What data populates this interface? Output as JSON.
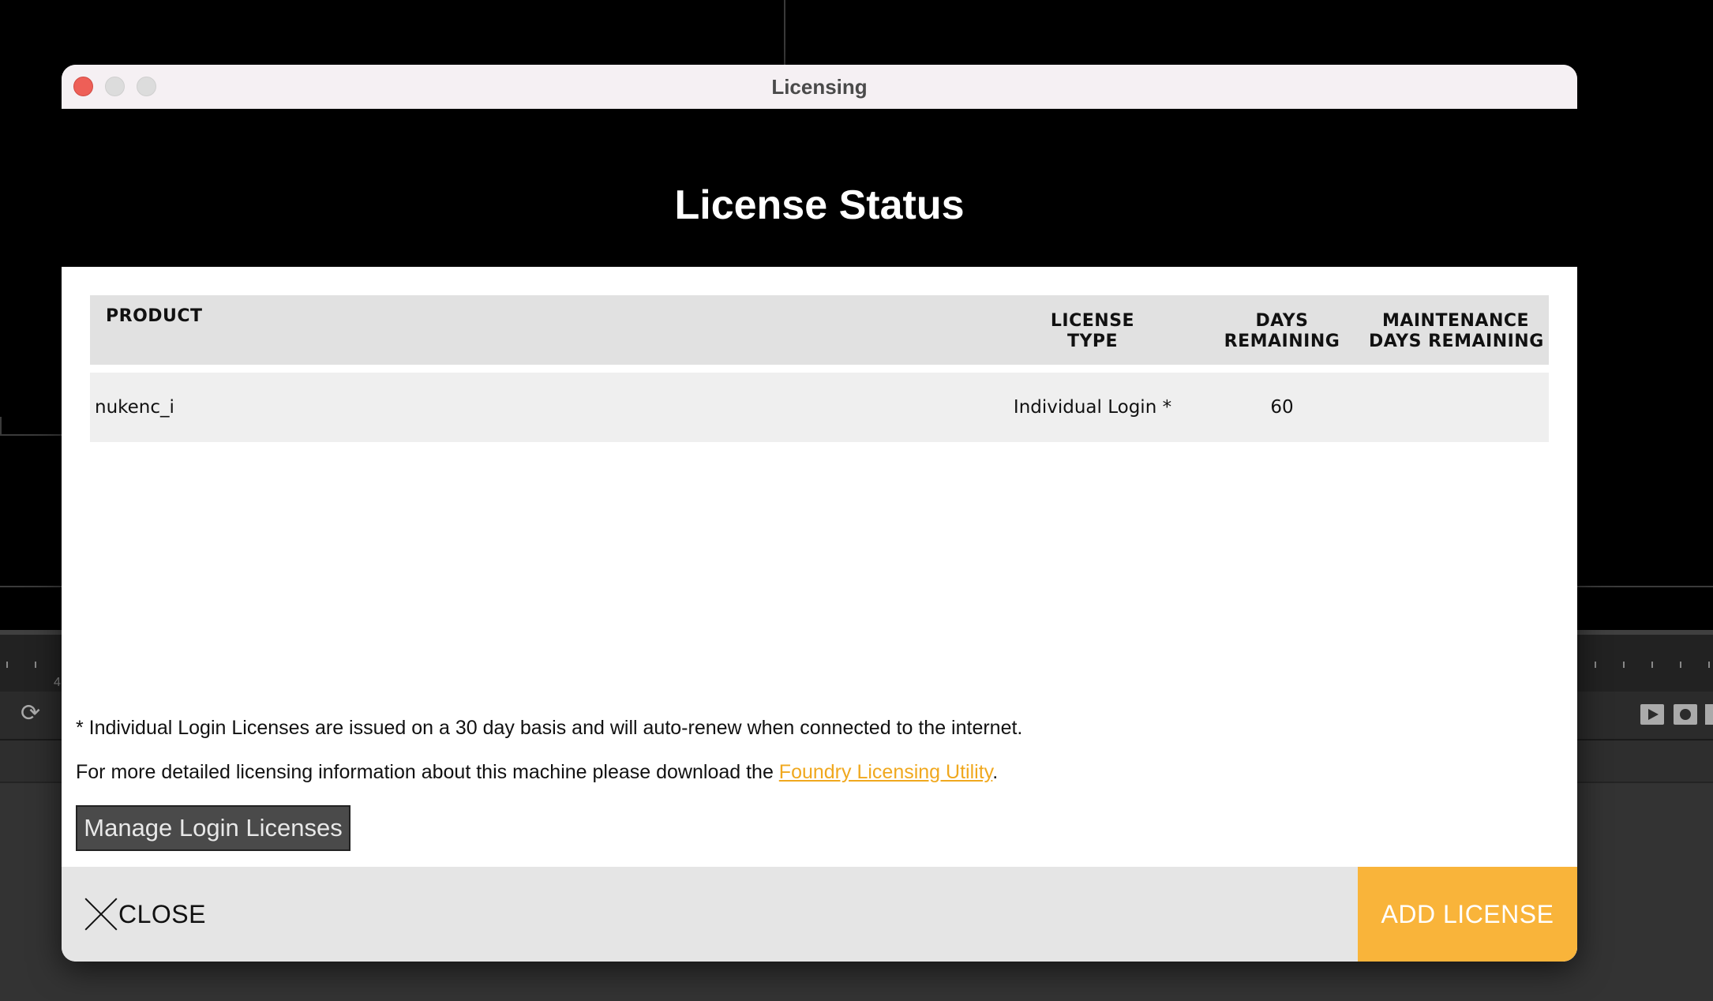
{
  "window": {
    "title": "Licensing"
  },
  "header": {
    "title": "License Status"
  },
  "table": {
    "columns": {
      "product": "PRODUCT",
      "license_type": [
        "LICENSE",
        "TYPE"
      ],
      "days_remaining": [
        "DAYS",
        "REMAINING"
      ],
      "maintenance": [
        "MAINTENANCE",
        "DAYS REMAINING"
      ]
    },
    "rows": [
      {
        "product": "nukenc_i",
        "license_type": "Individual Login *",
        "days_remaining": "60",
        "maintenance": ""
      }
    ]
  },
  "notes": {
    "individual": "* Individual Login Licenses are issued on a 30 day basis and will auto-renew when connected to the internet.",
    "detailed_prefix": "For more detailed licensing information about this machine please download the ",
    "utility_link": "Foundry Licensing Utility",
    "detailed_suffix": "."
  },
  "buttons": {
    "manage": "Manage Login Licenses",
    "close": "CLOSE",
    "add_license": "ADD LICENSE"
  },
  "colors": {
    "accent": "#f9b43a",
    "link": "#f0a81e",
    "header_band": "#000000"
  },
  "background_app": {
    "timeline_number": "4"
  }
}
